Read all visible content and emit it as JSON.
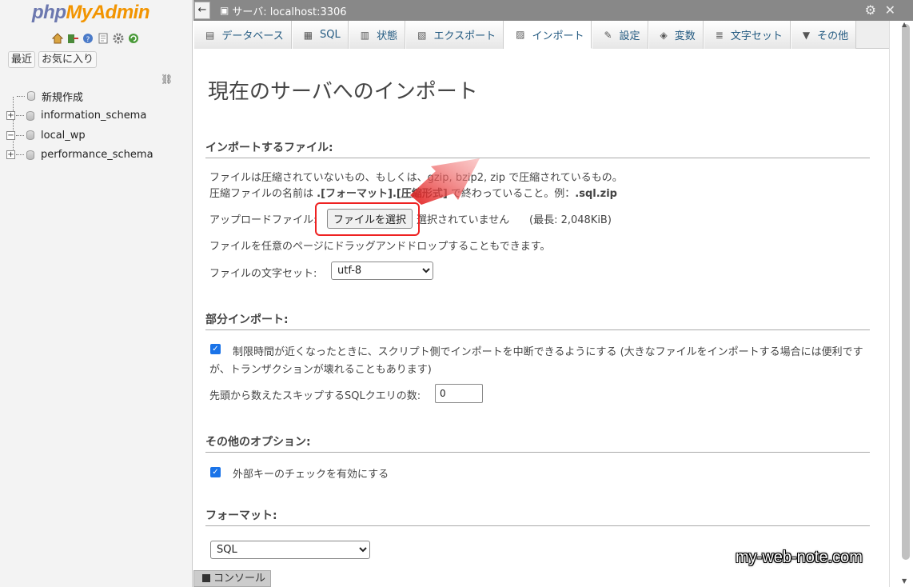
{
  "sidebar": {
    "logo": {
      "php": "php",
      "my": "My",
      "admin": "Admin"
    },
    "icons": [
      "home-icon",
      "exit-icon",
      "help-icon",
      "docs-icon",
      "settings-icon",
      "reload-icon"
    ],
    "tabs": [
      "最近",
      "お気に入り"
    ],
    "tree": [
      {
        "label": "新規作成",
        "expander": ""
      },
      {
        "label": "information_schema",
        "expander": "+"
      },
      {
        "label": "local_wp",
        "expander": "−"
      },
      {
        "label": "performance_schema",
        "expander": "+"
      }
    ]
  },
  "topbar": {
    "back": "←",
    "server": "サーバ: localhost:3306"
  },
  "tabs": [
    {
      "label": "データベース",
      "icon": "database-icon"
    },
    {
      "label": "SQL",
      "icon": "sql-icon"
    },
    {
      "label": "状態",
      "icon": "status-icon"
    },
    {
      "label": "エクスポート",
      "icon": "export-icon"
    },
    {
      "label": "インポート",
      "icon": "import-icon",
      "active": true
    },
    {
      "label": "設定",
      "icon": "wrench-icon"
    },
    {
      "label": "変数",
      "icon": "variables-icon"
    },
    {
      "label": "文字セット",
      "icon": "charset-icon"
    },
    {
      "label": "その他",
      "icon": "more-icon"
    }
  ],
  "main": {
    "title": "現在のサーバへのインポート",
    "file_section": {
      "heading": "インポートするファイル:",
      "line1": "ファイルは圧縮されていないもの、もしくは、gzip, bzip2, zip で圧縮されているもの。",
      "line2_a": "圧縮ファイルの名前は ",
      "line2_b": ".[フォーマット].[圧縮形式]",
      "line2_c": " で終わっていること。例：",
      "line2_d": ".sql.zip",
      "upload_label": "アップロードファイル:",
      "choose_button": "ファイルを選択",
      "no_file": "選択されていません",
      "max_size": "(最長: 2,048KiB)",
      "drag_text": "ファイルを任意のページにドラッグアンドドロップすることもできます。",
      "charset_label": "ファイルの文字セット:",
      "charset_value": "utf-8"
    },
    "partial_section": {
      "heading": "部分インポート:",
      "interrupt_line1": "制限時間が近くなったときに、スクリプト側でインポートを中断できるようにする (大きなファイルをインポートする場合には便利です",
      "interrupt_line2": "が、トランザクションが壊れることもあります)",
      "interrupt_checked": true,
      "skip_label": "先頭から数えたスキップするSQLクエリの数:",
      "skip_value": "0"
    },
    "other_section": {
      "heading": "その他のオプション:",
      "fk_label": "外部キーのチェックを有効にする",
      "fk_checked": true
    },
    "format_section": {
      "heading": "フォーマット:",
      "format_value": "SQL"
    }
  },
  "console": {
    "label": "コンソール"
  },
  "watermark": "my-web-note.com",
  "colors": {
    "highlight": "#e22222",
    "accent": "#1a73e8",
    "topbar": "#888888"
  }
}
